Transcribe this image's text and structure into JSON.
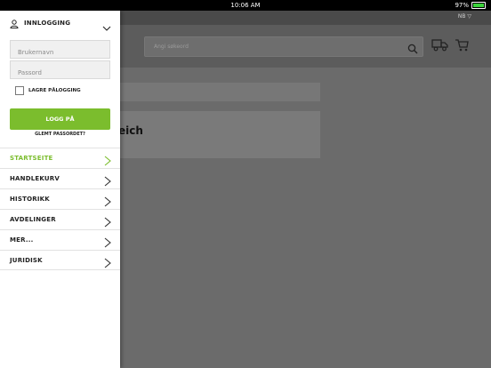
{
  "status_bar": {
    "time": "10:06 AM",
    "battery": "97%",
    "battery_level": 0.97
  },
  "app": {
    "language": "NB ▽",
    "search": {
      "placeholder": "Angi søkeord"
    },
    "card_title": "eich"
  },
  "drawer": {
    "login_title": "INNLOGGING",
    "username_placeholder": "Brukernavn",
    "password_placeholder": "Passord",
    "remember_label": "LAGRE PÅLOGGING",
    "login_button": "LOGG PÅ",
    "forgot_link": "GLEMT PASSORDET?",
    "menu": [
      {
        "label": "STARTSEITE",
        "active": true
      },
      {
        "label": "HANDLEKURV",
        "active": false
      },
      {
        "label": "HISTORIKK",
        "active": false
      },
      {
        "label": "AVDELINGER",
        "active": false
      },
      {
        "label": "MER...",
        "active": false
      },
      {
        "label": "JURIDISK",
        "active": false
      }
    ]
  },
  "colors": {
    "accent": "#7bbd2d",
    "overlay": "#6b6b6b"
  },
  "icons": [
    "user-icon",
    "chevron-down-icon",
    "search-icon",
    "truck-icon",
    "cart-icon",
    "chevron-right-icon"
  ]
}
